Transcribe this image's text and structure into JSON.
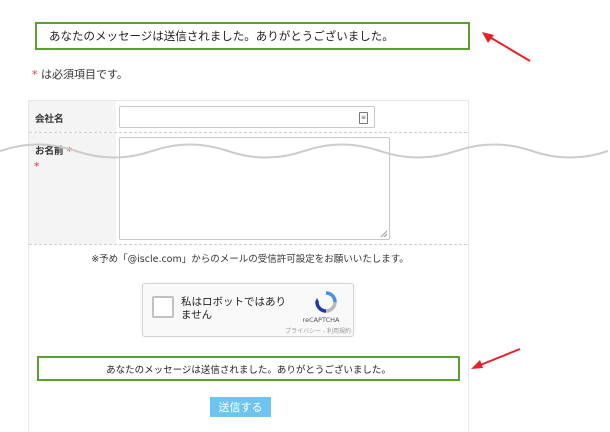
{
  "messages": {
    "top": "あなたのメッセージは送信されました。ありがとうございました。",
    "bottom": "あなたのメッセージは送信されました。ありがとうございました。"
  },
  "required_note": {
    "mark": "*",
    "text": " は必須項目です。"
  },
  "form": {
    "company": {
      "label": "会社名",
      "value": "",
      "icon": "contact-card-icon"
    },
    "name": {
      "label": "お名前",
      "mark": "*",
      "value": ""
    },
    "notice": "※予め「@iscle.com」からのメールの受信許可設定をお願いいたします。",
    "submit_label": "送信する"
  },
  "recaptcha": {
    "label": "私はロボットではありません",
    "brand": "reCAPTCHA",
    "terms": "プライバシー - 利用規約"
  },
  "colors": {
    "success_border": "#5aa02c",
    "required": "#e03030",
    "submit_bg": "#6fc4ef",
    "annotation_arrow": "#e8202a"
  }
}
